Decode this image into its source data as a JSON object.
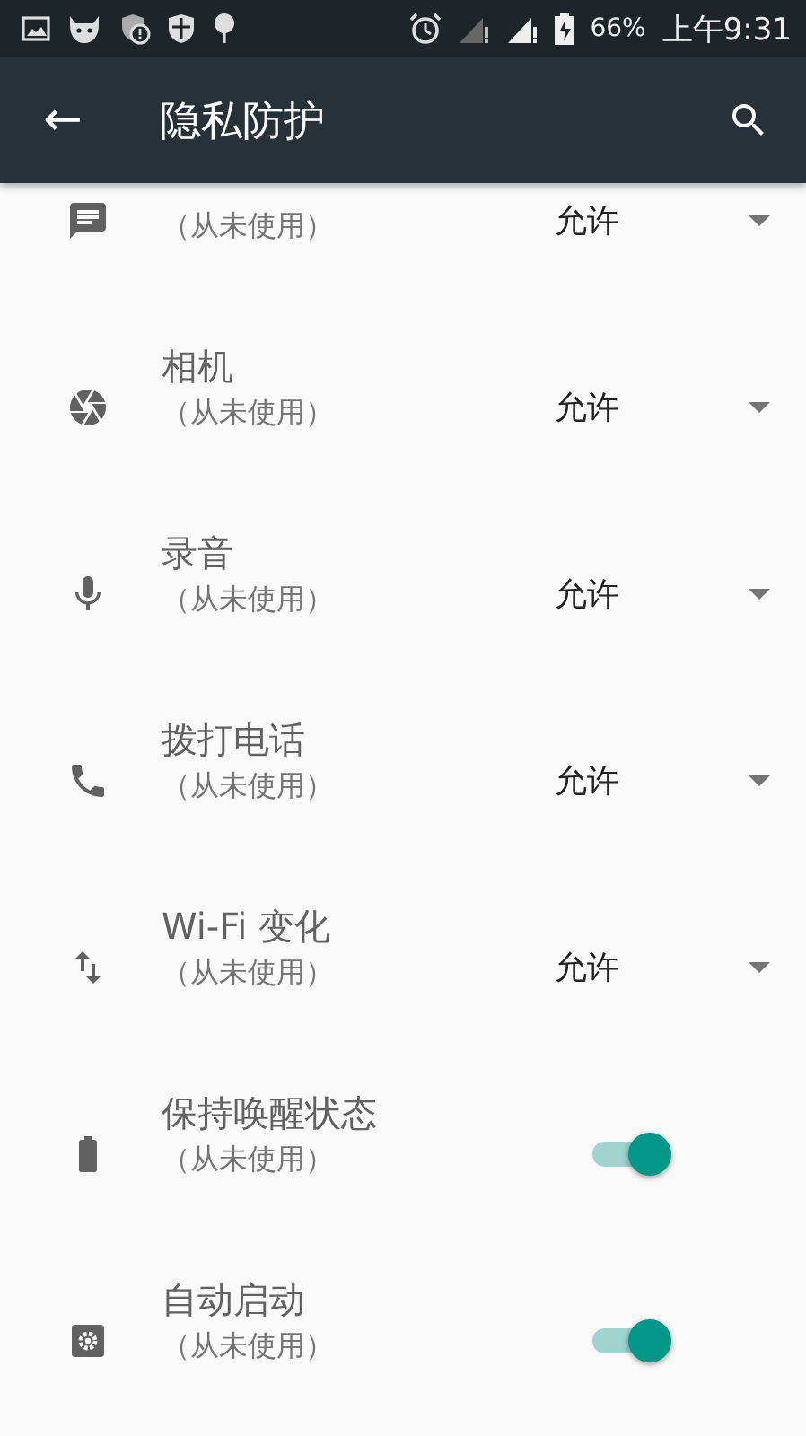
{
  "status_bar": {
    "battery": "66%",
    "time": "上午9:31"
  },
  "app_bar": {
    "back": "←",
    "title": "隐私防护"
  },
  "permissions": [
    {
      "kind": "dropdown",
      "subtitle": "（从未使用）",
      "value": "允许"
    },
    {
      "kind": "dropdown",
      "title": "相机",
      "subtitle": "（从未使用）",
      "value": "允许"
    },
    {
      "kind": "dropdown",
      "title": "录音",
      "subtitle": "（从未使用）",
      "value": "允许"
    },
    {
      "kind": "dropdown",
      "title": "拨打电话",
      "subtitle": "（从未使用）",
      "value": "允许"
    },
    {
      "kind": "dropdown",
      "title": "Wi-Fi 变化",
      "subtitle": "（从未使用）",
      "value": "允许"
    },
    {
      "kind": "switch",
      "title": "保持唤醒状态",
      "subtitle": "（从未使用）",
      "on": true
    },
    {
      "kind": "switch",
      "title": "自动启动",
      "subtitle": "（从未使用）",
      "on": true
    }
  ]
}
